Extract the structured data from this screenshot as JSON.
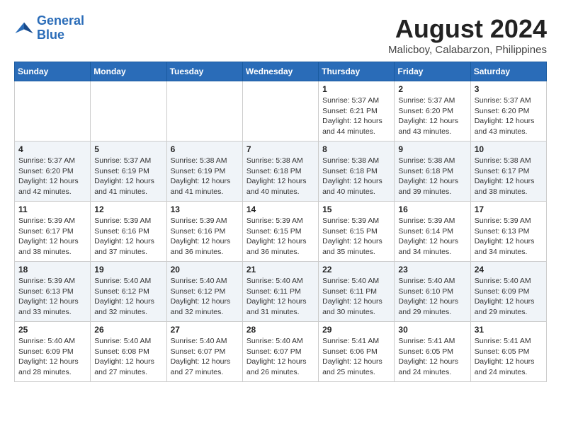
{
  "header": {
    "logo_line1": "General",
    "logo_line2": "Blue",
    "title": "August 2024",
    "subtitle": "Malicboy, Calabarzon, Philippines"
  },
  "weekdays": [
    "Sunday",
    "Monday",
    "Tuesday",
    "Wednesday",
    "Thursday",
    "Friday",
    "Saturday"
  ],
  "weeks": [
    [
      {
        "day": "",
        "info": ""
      },
      {
        "day": "",
        "info": ""
      },
      {
        "day": "",
        "info": ""
      },
      {
        "day": "",
        "info": ""
      },
      {
        "day": "1",
        "info": "Sunrise: 5:37 AM\nSunset: 6:21 PM\nDaylight: 12 hours\nand 44 minutes."
      },
      {
        "day": "2",
        "info": "Sunrise: 5:37 AM\nSunset: 6:20 PM\nDaylight: 12 hours\nand 43 minutes."
      },
      {
        "day": "3",
        "info": "Sunrise: 5:37 AM\nSunset: 6:20 PM\nDaylight: 12 hours\nand 43 minutes."
      }
    ],
    [
      {
        "day": "4",
        "info": "Sunrise: 5:37 AM\nSunset: 6:20 PM\nDaylight: 12 hours\nand 42 minutes."
      },
      {
        "day": "5",
        "info": "Sunrise: 5:37 AM\nSunset: 6:19 PM\nDaylight: 12 hours\nand 41 minutes."
      },
      {
        "day": "6",
        "info": "Sunrise: 5:38 AM\nSunset: 6:19 PM\nDaylight: 12 hours\nand 41 minutes."
      },
      {
        "day": "7",
        "info": "Sunrise: 5:38 AM\nSunset: 6:18 PM\nDaylight: 12 hours\nand 40 minutes."
      },
      {
        "day": "8",
        "info": "Sunrise: 5:38 AM\nSunset: 6:18 PM\nDaylight: 12 hours\nand 40 minutes."
      },
      {
        "day": "9",
        "info": "Sunrise: 5:38 AM\nSunset: 6:18 PM\nDaylight: 12 hours\nand 39 minutes."
      },
      {
        "day": "10",
        "info": "Sunrise: 5:38 AM\nSunset: 6:17 PM\nDaylight: 12 hours\nand 38 minutes."
      }
    ],
    [
      {
        "day": "11",
        "info": "Sunrise: 5:39 AM\nSunset: 6:17 PM\nDaylight: 12 hours\nand 38 minutes."
      },
      {
        "day": "12",
        "info": "Sunrise: 5:39 AM\nSunset: 6:16 PM\nDaylight: 12 hours\nand 37 minutes."
      },
      {
        "day": "13",
        "info": "Sunrise: 5:39 AM\nSunset: 6:16 PM\nDaylight: 12 hours\nand 36 minutes."
      },
      {
        "day": "14",
        "info": "Sunrise: 5:39 AM\nSunset: 6:15 PM\nDaylight: 12 hours\nand 36 minutes."
      },
      {
        "day": "15",
        "info": "Sunrise: 5:39 AM\nSunset: 6:15 PM\nDaylight: 12 hours\nand 35 minutes."
      },
      {
        "day": "16",
        "info": "Sunrise: 5:39 AM\nSunset: 6:14 PM\nDaylight: 12 hours\nand 34 minutes."
      },
      {
        "day": "17",
        "info": "Sunrise: 5:39 AM\nSunset: 6:13 PM\nDaylight: 12 hours\nand 34 minutes."
      }
    ],
    [
      {
        "day": "18",
        "info": "Sunrise: 5:39 AM\nSunset: 6:13 PM\nDaylight: 12 hours\nand 33 minutes."
      },
      {
        "day": "19",
        "info": "Sunrise: 5:40 AM\nSunset: 6:12 PM\nDaylight: 12 hours\nand 32 minutes."
      },
      {
        "day": "20",
        "info": "Sunrise: 5:40 AM\nSunset: 6:12 PM\nDaylight: 12 hours\nand 32 minutes."
      },
      {
        "day": "21",
        "info": "Sunrise: 5:40 AM\nSunset: 6:11 PM\nDaylight: 12 hours\nand 31 minutes."
      },
      {
        "day": "22",
        "info": "Sunrise: 5:40 AM\nSunset: 6:11 PM\nDaylight: 12 hours\nand 30 minutes."
      },
      {
        "day": "23",
        "info": "Sunrise: 5:40 AM\nSunset: 6:10 PM\nDaylight: 12 hours\nand 29 minutes."
      },
      {
        "day": "24",
        "info": "Sunrise: 5:40 AM\nSunset: 6:09 PM\nDaylight: 12 hours\nand 29 minutes."
      }
    ],
    [
      {
        "day": "25",
        "info": "Sunrise: 5:40 AM\nSunset: 6:09 PM\nDaylight: 12 hours\nand 28 minutes."
      },
      {
        "day": "26",
        "info": "Sunrise: 5:40 AM\nSunset: 6:08 PM\nDaylight: 12 hours\nand 27 minutes."
      },
      {
        "day": "27",
        "info": "Sunrise: 5:40 AM\nSunset: 6:07 PM\nDaylight: 12 hours\nand 27 minutes."
      },
      {
        "day": "28",
        "info": "Sunrise: 5:40 AM\nSunset: 6:07 PM\nDaylight: 12 hours\nand 26 minutes."
      },
      {
        "day": "29",
        "info": "Sunrise: 5:41 AM\nSunset: 6:06 PM\nDaylight: 12 hours\nand 25 minutes."
      },
      {
        "day": "30",
        "info": "Sunrise: 5:41 AM\nSunset: 6:05 PM\nDaylight: 12 hours\nand 24 minutes."
      },
      {
        "day": "31",
        "info": "Sunrise: 5:41 AM\nSunset: 6:05 PM\nDaylight: 12 hours\nand 24 minutes."
      }
    ]
  ]
}
